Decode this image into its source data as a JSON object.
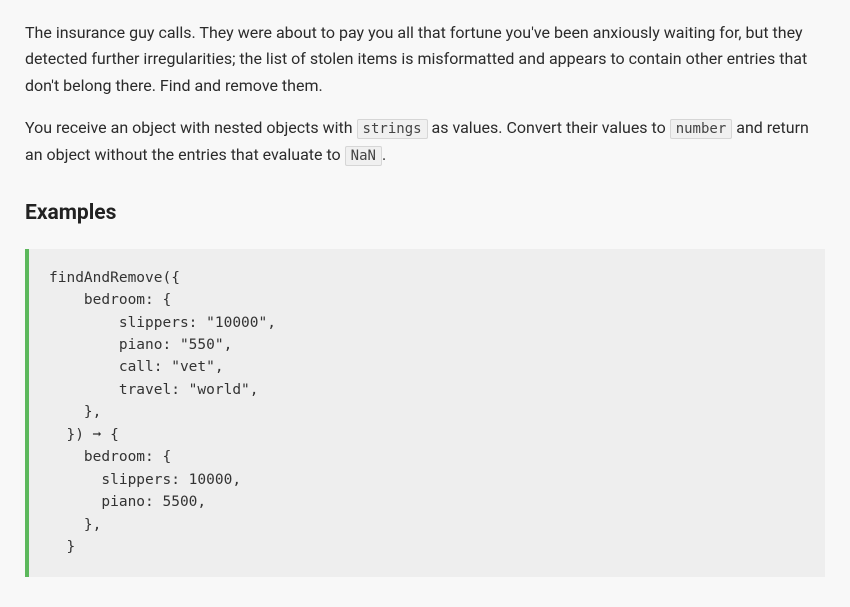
{
  "para1": "The insurance guy calls. They were about to pay you all that fortune you've been anxiously waiting for, but they detected further irregularities; the list of stolen items is misformatted and appears to contain other entries that don't belong there. Find and remove them.",
  "para2_pre": "You receive an object with nested objects with ",
  "code_strings": "strings",
  "para2_mid": " as values. Convert their values to ",
  "code_number": "number",
  "para2_mid2": " and return an object without the entries that evaluate to ",
  "code_nan": "NaN",
  "para2_end": ".",
  "heading_examples": "Examples",
  "codeblock": "findAndRemove({\n    bedroom: {\n        slippers: \"10000\",\n        piano: \"550\",\n        call: \"vet\",\n        travel: \"world\",\n    },\n  }) ➞ {\n    bedroom: {\n      slippers: 10000,\n      piano: 5500,\n    },\n  }"
}
